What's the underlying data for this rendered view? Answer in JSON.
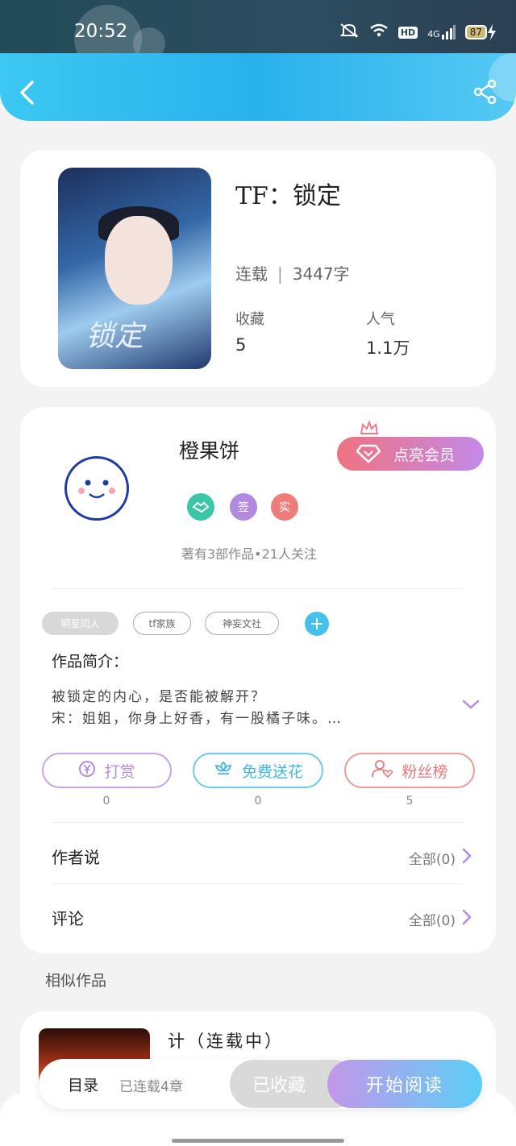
{
  "status_bar": {
    "time": "20:52",
    "network": "4G",
    "battery": "87",
    "hd": "HD"
  },
  "book": {
    "title": "TF：锁定",
    "status": "连载",
    "word_count": "3447字",
    "favorites_label": "收藏",
    "favorites": "5",
    "popularity_label": "人气",
    "popularity": "1.1万",
    "cover_title": "锁定"
  },
  "author": {
    "name": "橙果饼",
    "vip_label": "点亮会员",
    "badges": [
      "签",
      "实"
    ],
    "stats": "著有3部作品•21人关注"
  },
  "tags": [
    "明星同人",
    "tf家族",
    "神妄文社"
  ],
  "intro": {
    "label": "作品简介：",
    "line1": "被锁定的内心，是否能被解开？",
    "line2": "宋：姐姐，你身上好香，有一股橘子味。…"
  },
  "actions": [
    {
      "label": "打赏",
      "count": "0"
    },
    {
      "label": "免费送花",
      "count": "0"
    },
    {
      "label": "粉丝榜",
      "count": "5"
    }
  ],
  "rows": {
    "author_says": "作者说",
    "author_says_all": "全部(0)",
    "comments": "评论",
    "comments_all": "全部(0)"
  },
  "similar": {
    "heading": "相似作品",
    "title": "计（连载中）"
  },
  "bottom": {
    "toc": "目录",
    "chapters": "已连载4章",
    "collected": "已收藏",
    "read": "开始阅读"
  },
  "colors": {
    "accent_blue": "#2cb3ec",
    "purple": "#b58ae0",
    "cyan": "#40c0e8",
    "red": "#e8787c"
  }
}
